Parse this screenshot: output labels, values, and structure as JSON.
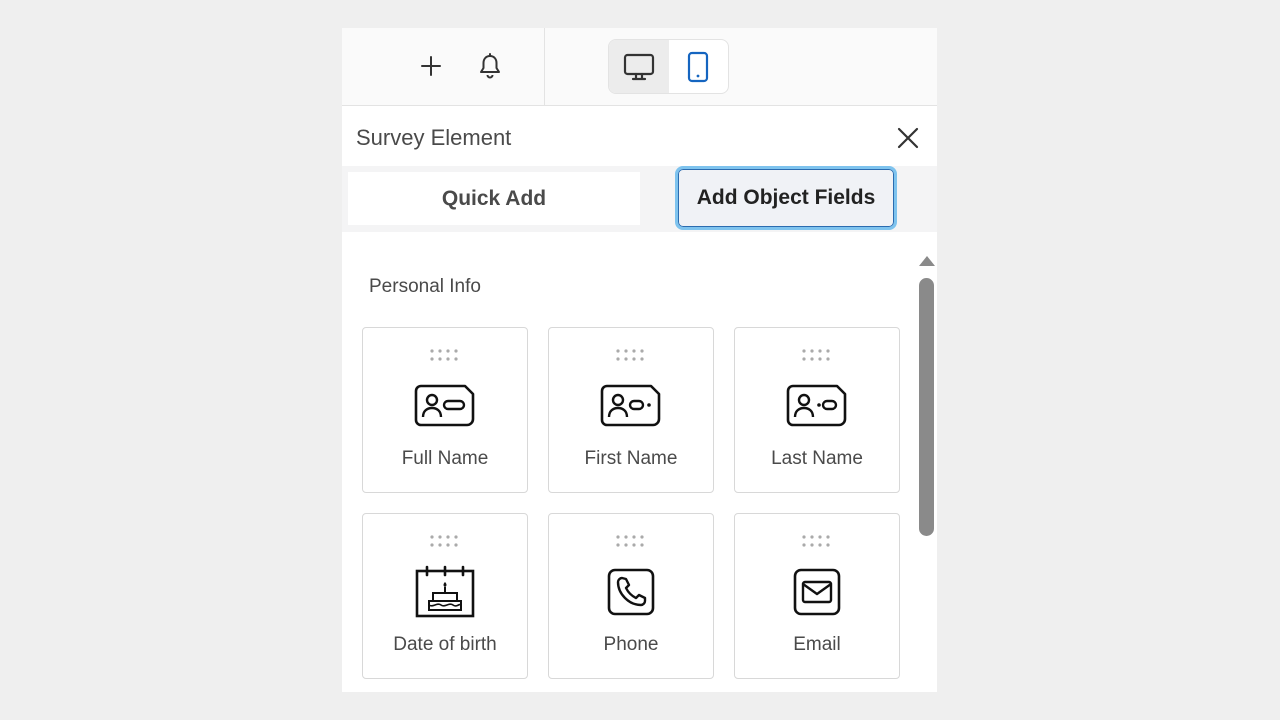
{
  "toolbar": {
    "add_icon": "plus-icon",
    "notifications_icon": "bell-icon",
    "device_toggle": {
      "desktop_icon": "desktop-monitor-icon",
      "mobile_icon": "mobile-phone-icon",
      "selected": "mobile"
    }
  },
  "panel": {
    "title": "Survey Element",
    "close_icon": "close-icon",
    "tabs": [
      {
        "label": "Quick Add",
        "active": false
      },
      {
        "label": "Add Object Fields",
        "active": true
      }
    ],
    "section_title": "Personal Info",
    "fields": [
      {
        "label": "Full Name",
        "icon": "id-card-icon"
      },
      {
        "label": "First Name",
        "icon": "id-card-icon"
      },
      {
        "label": "Last Name",
        "icon": "id-card-icon"
      },
      {
        "label": "Date of birth",
        "icon": "birthday-cake-icon"
      },
      {
        "label": "Phone",
        "icon": "phone-icon"
      },
      {
        "label": "Email",
        "icon": "envelope-icon"
      }
    ]
  },
  "colors": {
    "accent": "#1565c0",
    "active_tab_border": "#7ec3ee",
    "page_background": "#efefef"
  }
}
